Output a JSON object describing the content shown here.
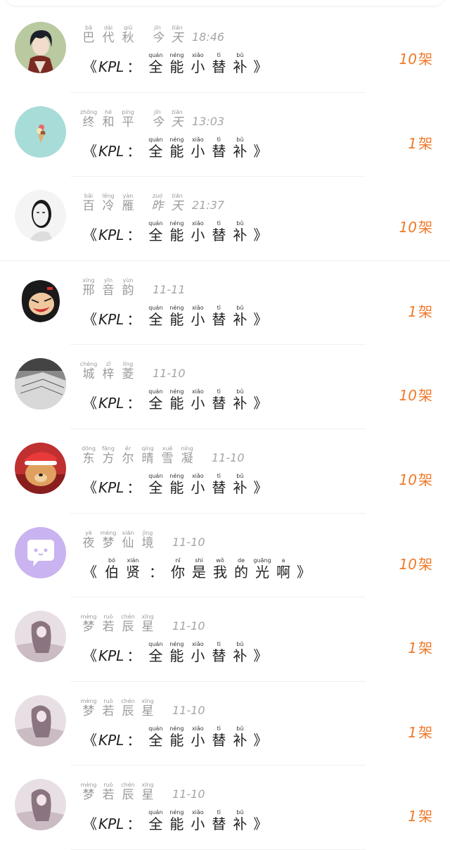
{
  "unit": "架",
  "kpl_label": "KPL",
  "open_bracket": "《",
  "close_bracket": "》",
  "colon": "：",
  "gift_name": [
    {
      "p": "quán",
      "c": "全"
    },
    {
      "p": "néng",
      "c": "能"
    },
    {
      "p": "xiǎo",
      "c": "小"
    },
    {
      "p": "tì",
      "c": "替"
    },
    {
      "p": "bǔ",
      "c": "补"
    }
  ],
  "items": [
    {
      "name": [
        {
          "p": "bā",
          "c": "巴"
        },
        {
          "p": "dài",
          "c": "代"
        },
        {
          "p": "qiū",
          "c": "秋"
        }
      ],
      "day": [
        {
          "p": "jīn",
          "c": "今"
        },
        {
          "p": "tiān",
          "c": "天"
        }
      ],
      "clock": "18:46",
      "count": "10",
      "gift": "kpl",
      "avatar": "anime-boy"
    },
    {
      "name": [
        {
          "p": "zhōng",
          "c": "终"
        },
        {
          "p": "hé",
          "c": "和"
        },
        {
          "p": "píng",
          "c": "平"
        }
      ],
      "day": [
        {
          "p": "jīn",
          "c": "今"
        },
        {
          "p": "tiān",
          "c": "天"
        }
      ],
      "clock": "13:03",
      "count": "1",
      "gift": "kpl",
      "avatar": "ice-cream"
    },
    {
      "name": [
        {
          "p": "bǎi",
          "c": "百"
        },
        {
          "p": "lěng",
          "c": "冷"
        },
        {
          "p": "yàn",
          "c": "雁"
        }
      ],
      "day": [
        {
          "p": "zuó",
          "c": "昨"
        },
        {
          "p": "tiān",
          "c": "天"
        }
      ],
      "clock": "21:37",
      "count": "10",
      "gift": "kpl",
      "avatar": "mask"
    },
    {
      "name": [
        {
          "p": "xíng",
          "c": "邢"
        },
        {
          "p": "yīn",
          "c": "音"
        },
        {
          "p": "yùn",
          "c": "韵"
        }
      ],
      "day": [],
      "clock": "11-11",
      "count": "1",
      "gift": "kpl",
      "avatar": "cartoon-laugh"
    },
    {
      "name": [
        {
          "p": "chéng",
          "c": "城"
        },
        {
          "p": "zǐ",
          "c": "梓"
        },
        {
          "p": "líng",
          "c": "菱"
        }
      ],
      "day": [],
      "clock": "11-10",
      "count": "10",
      "gift": "kpl",
      "avatar": "book-bw"
    },
    {
      "name": [
        {
          "p": "dōng",
          "c": "东"
        },
        {
          "p": "fāng",
          "c": "方"
        },
        {
          "p": "ěr",
          "c": "尔"
        },
        {
          "p": "qíng",
          "c": "晴"
        },
        {
          "p": "xuě",
          "c": "雪"
        },
        {
          "p": "níng",
          "c": "凝"
        }
      ],
      "day": [],
      "clock": "11-10",
      "count": "10",
      "gift": "kpl",
      "avatar": "dog-santa"
    },
    {
      "name": [
        {
          "p": "yè",
          "c": "夜"
        },
        {
          "p": "mèng",
          "c": "梦"
        },
        {
          "p": "xiān",
          "c": "仙"
        },
        {
          "p": "jìng",
          "c": "境"
        }
      ],
      "day": [],
      "clock": "11-10",
      "count": "10",
      "gift": "bo",
      "avatar": "chat-bubble"
    },
    {
      "name": [
        {
          "p": "mèng",
          "c": "梦"
        },
        {
          "p": "ruò",
          "c": "若"
        },
        {
          "p": "chén",
          "c": "辰"
        },
        {
          "p": "xīng",
          "c": "星"
        }
      ],
      "day": [],
      "clock": "11-10",
      "count": "1",
      "gift": "kpl",
      "avatar": "girl-sketch"
    },
    {
      "name": [
        {
          "p": "mèng",
          "c": "梦"
        },
        {
          "p": "ruò",
          "c": "若"
        },
        {
          "p": "chén",
          "c": "辰"
        },
        {
          "p": "xīng",
          "c": "星"
        }
      ],
      "day": [],
      "clock": "11-10",
      "count": "1",
      "gift": "kpl",
      "avatar": "girl-sketch"
    },
    {
      "name": [
        {
          "p": "mèng",
          "c": "梦"
        },
        {
          "p": "ruò",
          "c": "若"
        },
        {
          "p": "chén",
          "c": "辰"
        },
        {
          "p": "xīng",
          "c": "星"
        }
      ],
      "day": [],
      "clock": "11-10",
      "count": "1",
      "gift": "kpl",
      "avatar": "girl-sketch"
    }
  ],
  "bo_gift": {
    "author": [
      {
        "p": "bó",
        "c": "伯"
      },
      {
        "p": "xián",
        "c": "贤"
      }
    ],
    "title": [
      {
        "p": "nǐ",
        "c": "你"
      },
      {
        "p": "shì",
        "c": "是"
      },
      {
        "p": "wǒ",
        "c": "我"
      },
      {
        "p": "de",
        "c": "的"
      },
      {
        "p": "guāng",
        "c": "光"
      },
      {
        "p": "a",
        "c": "啊"
      }
    ]
  },
  "colors": {
    "accent": "#f07a2a",
    "name": "#9a9a9a",
    "text": "#222222",
    "bubble": "#c9b3f0"
  }
}
